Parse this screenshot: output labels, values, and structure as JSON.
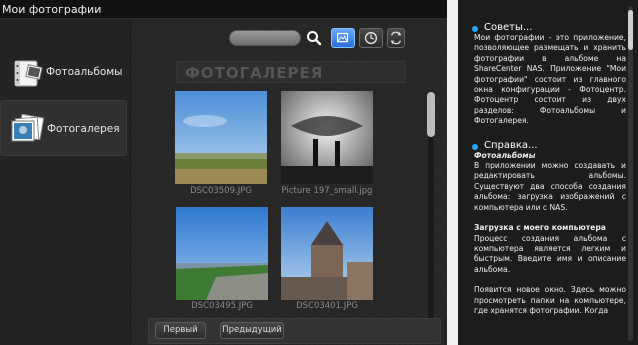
{
  "window": {
    "title": "Мои фотографии"
  },
  "sidebar": {
    "items": [
      {
        "label": "Фотоальбомы",
        "icon": "album-book-icon",
        "active": false
      },
      {
        "label": "Фотогалерея",
        "icon": "photo-stack-icon",
        "active": true
      }
    ]
  },
  "toolbar": {
    "search_value": "",
    "buttons": [
      "search-icon",
      "photo-view-icon",
      "clock-icon",
      "refresh-icon"
    ]
  },
  "gallery": {
    "title": "ФОТОГАЛЕРЕЯ",
    "photos": [
      {
        "caption": "DSC03509.JPG"
      },
      {
        "caption": "Picture 197_small.jpg"
      },
      {
        "caption": "DSC03495.JPG"
      },
      {
        "caption": "DSC03401.JPG"
      }
    ]
  },
  "pager": {
    "first": "Первый",
    "prev": "Предыдущий"
  },
  "help": {
    "section1": {
      "title": "Советы...",
      "text": "Мои фотографии - это приложение, позволяющее размещать и хранить фотографии в альбоме на ShareCenter NAS. Приложение \"Мои фотографии\" состоит из главного окна конфигурации - Фотоцентр. Фотоцентр состоит из двух разделов: Фотоальбомы и Фотогалерея."
    },
    "section2": {
      "title": "Справка...",
      "subtitle": "Фотоальбомы",
      "text1": "В приложении можно создавать и редактировать альбомы. Существуют два способа создания альбома: загрузка изображений с компьютера или с NAS.",
      "upload_title": "Загрузка с моего компьютера",
      "text2": "Процесс создания альбома с компьютера является легким и быстрым. Введите имя и описание альбома.",
      "text3": "Появится новое окно. Здесь можно просмотреть папки на компьютере, где хранятся фотографии. Когда"
    }
  },
  "colors": {
    "accent": "#2ba4ff",
    "active_button": "#3a82e8"
  }
}
